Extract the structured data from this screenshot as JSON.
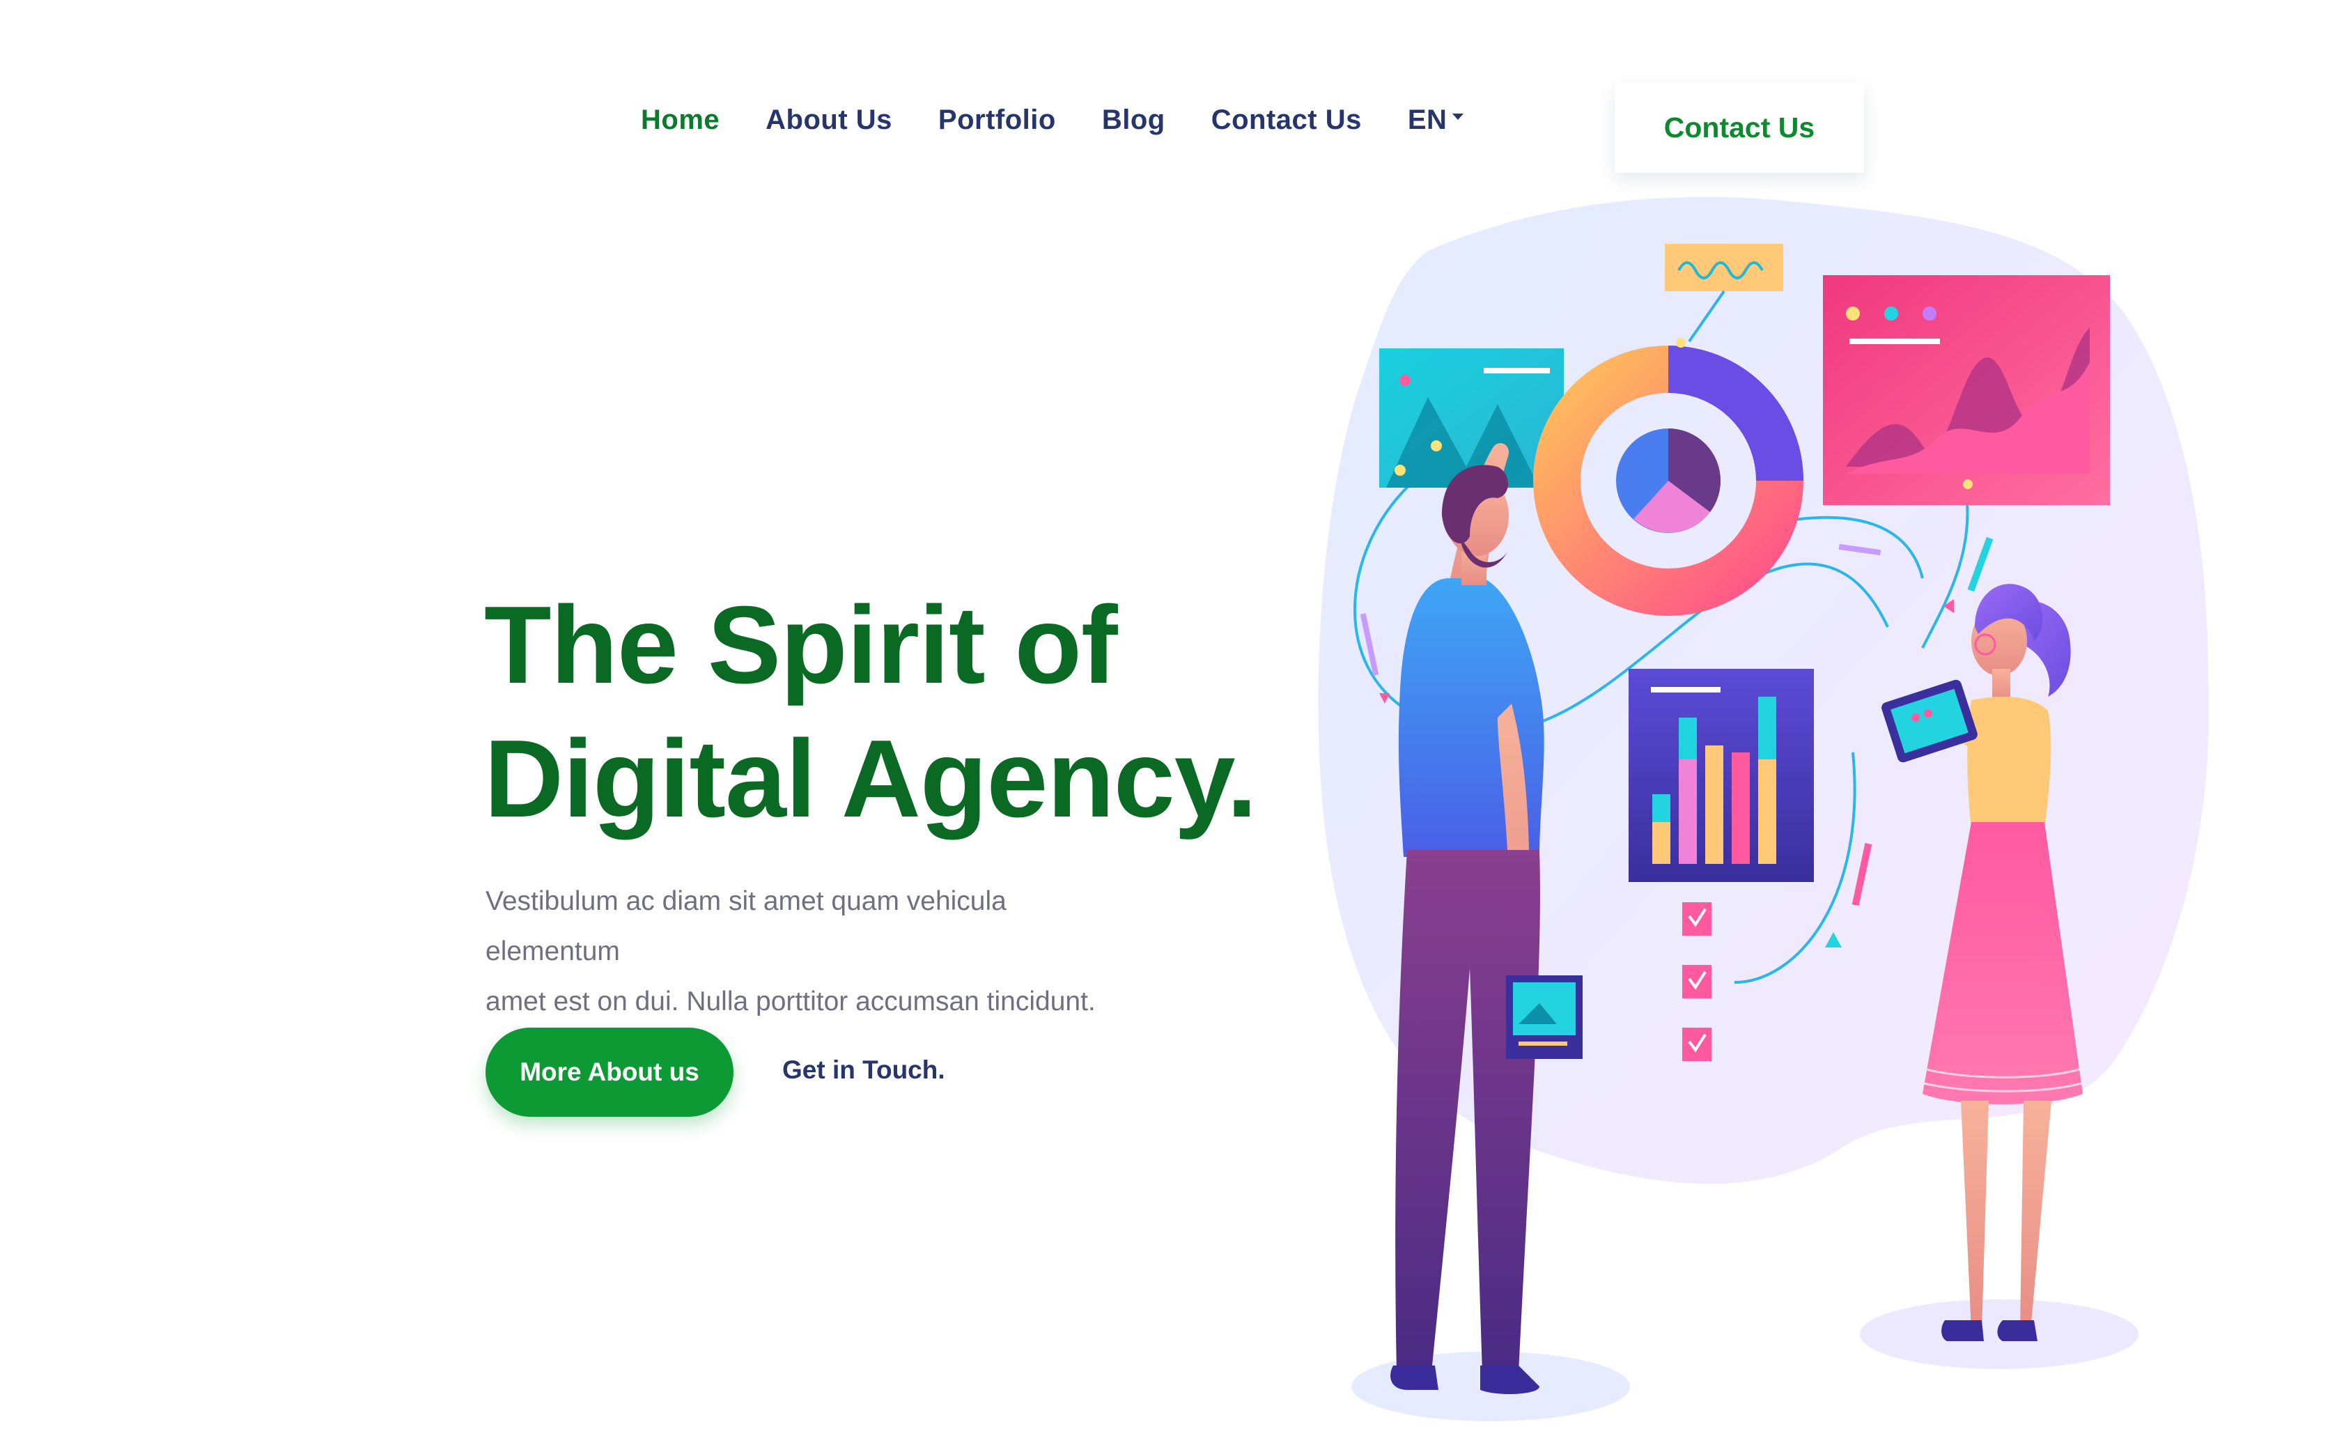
{
  "nav": {
    "items": [
      {
        "label": "Home",
        "active": true
      },
      {
        "label": "About Us",
        "active": false
      },
      {
        "label": "Portfolio",
        "active": false
      },
      {
        "label": "Blog",
        "active": false
      },
      {
        "label": "Contact Us",
        "active": false
      }
    ],
    "language": {
      "label": "EN",
      "icon": "caret-down-icon"
    },
    "cta_label": "Contact Us"
  },
  "hero": {
    "title_line1": "The Spirit of",
    "title_line2": "Digital Agency.",
    "description_line1": "Vestibulum ac diam sit amet quam vehicula elementum",
    "description_line2": "amet est on dui. Nulla porttitor accumsan tincidunt.",
    "primary_button": "More About us",
    "secondary_link": "Get in Touch."
  },
  "colors": {
    "brand_green": "#0a6a23",
    "button_green": "#0d9a35",
    "nav_text": "#27356d",
    "body_text": "#6e7080"
  }
}
